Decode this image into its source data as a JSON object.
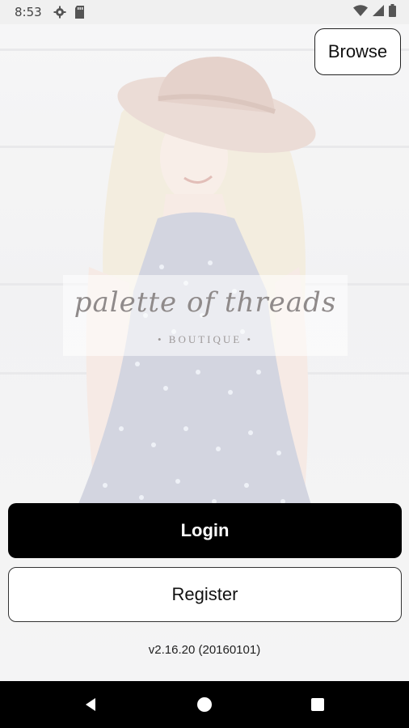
{
  "status_bar": {
    "time": "8:53",
    "left_icons": [
      "gear-icon",
      "sd-card-icon"
    ],
    "right_icons": [
      "wifi-icon",
      "signal-icon",
      "battery-icon"
    ]
  },
  "header": {
    "browse_label": "Browse"
  },
  "logo": {
    "script_text": "palette of threads",
    "sub_text": "• BOUTIQUE •"
  },
  "actions": {
    "login_label": "Login",
    "register_label": "Register"
  },
  "footer": {
    "version": "v2.16.20 (20160101)"
  },
  "nav_bar": {
    "icons": [
      "back-icon",
      "home-icon",
      "recents-icon"
    ]
  },
  "colors": {
    "primary_button": "#000000",
    "secondary_button": "#ffffff",
    "nav_bar": "#000000"
  }
}
